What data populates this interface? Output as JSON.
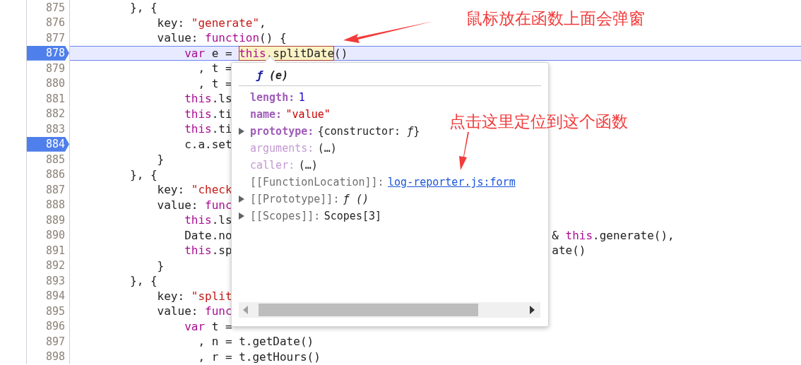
{
  "lines": [
    {
      "number": "875",
      "breakpoint": false,
      "current": false,
      "code": [
        {
          "kind": "plain",
          "text": "        }, {"
        }
      ]
    },
    {
      "number": "876",
      "breakpoint": false,
      "current": false,
      "code": [
        {
          "kind": "plain",
          "text": "            key: "
        },
        {
          "kind": "string",
          "text": "\"generate\""
        },
        {
          "kind": "plain",
          "text": ","
        }
      ]
    },
    {
      "number": "877",
      "breakpoint": false,
      "current": false,
      "code": [
        {
          "kind": "plain",
          "text": "            value: "
        },
        {
          "kind": "keyword",
          "text": "function"
        },
        {
          "kind": "plain",
          "text": "() {"
        }
      ]
    },
    {
      "number": "878",
      "breakpoint": true,
      "current": true,
      "code": [
        {
          "kind": "keyword",
          "text": "                var"
        },
        {
          "kind": "plain",
          "text": " e = "
        },
        {
          "kind": "hover",
          "parts": [
            {
              "kind": "keyword",
              "text": "this"
            },
            {
              "kind": "plain",
              "text": ".splitDate"
            }
          ]
        },
        {
          "kind": "plain",
          "text": "()"
        }
      ]
    },
    {
      "number": "879",
      "breakpoint": false,
      "current": false,
      "code": [
        {
          "kind": "plain",
          "text": "                  , t ="
        }
      ]
    },
    {
      "number": "880",
      "breakpoint": false,
      "current": false,
      "code": [
        {
          "kind": "plain",
          "text": "                  , t ="
        }
      ]
    },
    {
      "number": "881",
      "breakpoint": false,
      "current": false,
      "code": [
        {
          "kind": "keyword",
          "text": "                this"
        },
        {
          "kind": "plain",
          "text": ".ls"
        }
      ]
    },
    {
      "number": "882",
      "breakpoint": false,
      "current": false,
      "code": [
        {
          "kind": "keyword",
          "text": "                this"
        },
        {
          "kind": "plain",
          "text": ".ti"
        }
      ]
    },
    {
      "number": "883",
      "breakpoint": false,
      "current": false,
      "code": [
        {
          "kind": "keyword",
          "text": "                this"
        },
        {
          "kind": "plain",
          "text": ".ti"
        }
      ]
    },
    {
      "number": "884",
      "breakpoint": true,
      "current": false,
      "code": [
        {
          "kind": "plain",
          "text": "                c.a.set"
        }
      ]
    },
    {
      "number": "885",
      "breakpoint": false,
      "current": false,
      "code": [
        {
          "kind": "plain",
          "text": "            }"
        }
      ]
    },
    {
      "number": "886",
      "breakpoint": false,
      "current": false,
      "code": [
        {
          "kind": "plain",
          "text": "        }, {"
        }
      ]
    },
    {
      "number": "887",
      "breakpoint": false,
      "current": false,
      "code": [
        {
          "kind": "plain",
          "text": "            key: "
        },
        {
          "kind": "string",
          "text": "\"check"
        }
      ]
    },
    {
      "number": "888",
      "breakpoint": false,
      "current": false,
      "code": [
        {
          "kind": "plain",
          "text": "            value: "
        },
        {
          "kind": "keyword",
          "text": "func"
        }
      ]
    },
    {
      "number": "889",
      "breakpoint": false,
      "current": false,
      "code": [
        {
          "kind": "keyword",
          "text": "                this"
        },
        {
          "kind": "plain",
          "text": ".ls"
        }
      ]
    },
    {
      "number": "890",
      "breakpoint": false,
      "current": false,
      "code": [
        {
          "kind": "plain",
          "text": "                Date.no"
        }
      ],
      "tail": [
        {
          "kind": "plain",
          "text": "& "
        },
        {
          "kind": "keyword",
          "text": "this"
        },
        {
          "kind": "plain",
          "text": ".generate(),"
        }
      ]
    },
    {
      "number": "891",
      "breakpoint": false,
      "current": false,
      "code": [
        {
          "kind": "keyword",
          "text": "                this"
        },
        {
          "kind": "plain",
          "text": ".sp"
        }
      ],
      "tail": [
        {
          "kind": "plain",
          "text": "ate()"
        }
      ]
    },
    {
      "number": "892",
      "breakpoint": false,
      "current": false,
      "code": [
        {
          "kind": "plain",
          "text": "            }"
        }
      ]
    },
    {
      "number": "893",
      "breakpoint": false,
      "current": false,
      "code": [
        {
          "kind": "plain",
          "text": "        }, {"
        }
      ]
    },
    {
      "number": "894",
      "breakpoint": false,
      "current": false,
      "code": [
        {
          "kind": "plain",
          "text": "            key: "
        },
        {
          "kind": "string",
          "text": "\"split"
        }
      ]
    },
    {
      "number": "895",
      "breakpoint": false,
      "current": false,
      "code": [
        {
          "kind": "plain",
          "text": "            value: "
        },
        {
          "kind": "keyword",
          "text": "func"
        }
      ]
    },
    {
      "number": "896",
      "breakpoint": false,
      "current": false,
      "code": [
        {
          "kind": "keyword",
          "text": "                var"
        },
        {
          "kind": "plain",
          "text": " t ="
        }
      ]
    },
    {
      "number": "897",
      "breakpoint": false,
      "current": false,
      "code": [
        {
          "kind": "plain",
          "text": "                  , n = t.getDate()"
        }
      ]
    },
    {
      "number": "898",
      "breakpoint": false,
      "current": false,
      "code": [
        {
          "kind": "plain",
          "text": "                  , r = t.getHours()"
        }
      ]
    }
  ],
  "popover": {
    "signature": [
      {
        "kind": "f",
        "text": "ƒ"
      },
      {
        "kind": "args",
        "text": " (e)"
      }
    ],
    "properties": [
      {
        "kind": "own",
        "expandable": false,
        "key": "length:",
        "value": [
          {
            "kind": "number",
            "text": "1"
          }
        ]
      },
      {
        "kind": "own",
        "expandable": false,
        "key": "name:",
        "value": [
          {
            "kind": "string",
            "text": "\"value\""
          }
        ]
      },
      {
        "kind": "own",
        "expandable": true,
        "key": "prototype:",
        "value": [
          {
            "kind": "plain",
            "text": "{constructor: "
          },
          {
            "kind": "f",
            "text": "ƒ"
          },
          {
            "kind": "plain",
            "text": "}"
          }
        ]
      },
      {
        "kind": "faded",
        "expandable": false,
        "key": "arguments:",
        "value": [
          {
            "kind": "plain",
            "text": "(…)"
          }
        ]
      },
      {
        "kind": "faded",
        "expandable": false,
        "key": "caller:",
        "value": [
          {
            "kind": "plain",
            "text": "(…)"
          }
        ]
      },
      {
        "kind": "internal",
        "expandable": false,
        "key": "[[FunctionLocation]]:",
        "value": [
          {
            "kind": "link",
            "text": "log-reporter.js:form"
          }
        ]
      },
      {
        "kind": "internal",
        "expandable": true,
        "key": "[[Prototype]]:",
        "value": [
          {
            "kind": "f",
            "text": "ƒ"
          },
          {
            "kind": "italic",
            "text": " ()"
          }
        ]
      },
      {
        "kind": "internal",
        "expandable": true,
        "key": "[[Scopes]]:",
        "value": [
          {
            "kind": "plain",
            "text": "Scopes[3]"
          }
        ]
      }
    ]
  },
  "annotations": [
    {
      "text": "鼠标放在函数上面会弹窗"
    },
    {
      "text": "点击这里定位到这个函数"
    }
  ]
}
